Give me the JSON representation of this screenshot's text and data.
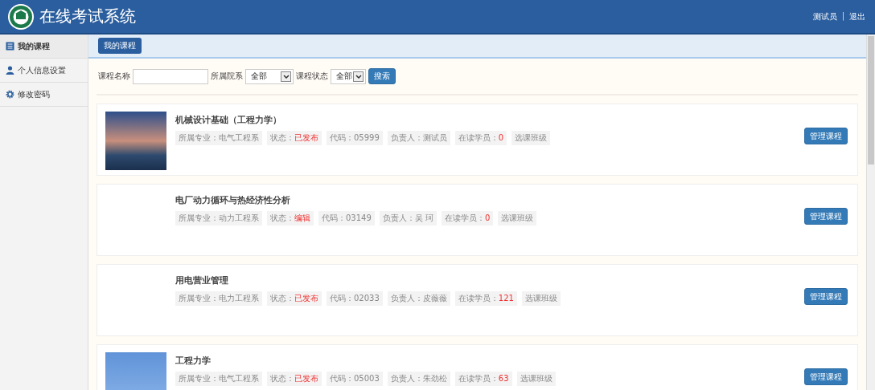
{
  "header": {
    "title": "在线考试系统",
    "user": "测试员",
    "separator": "|",
    "logout": "退出"
  },
  "sidebar": {
    "items": [
      {
        "label": "我的课程",
        "selected": true
      },
      {
        "label": "个人信息设置",
        "selected": false
      },
      {
        "label": "修改密码",
        "selected": false
      }
    ]
  },
  "tabs": [
    {
      "label": "我的课程",
      "selected": true
    }
  ],
  "filters": {
    "name_label": "课程名称",
    "department_label": "所属院系",
    "department_value": "全部",
    "status_label": "课程状态",
    "status_value": "全部",
    "search_button": "搜索"
  },
  "courses": [
    {
      "title": "机械设计基础（工程力学）",
      "photo": true,
      "tags": [
        {
          "label": "所属专业：",
          "value": "电气工程系",
          "emphasis": false
        },
        {
          "label": "状态：",
          "value": "已发布",
          "emphasis": true
        },
        {
          "label": "代码：",
          "value": "05999",
          "emphasis": false
        },
        {
          "label": "负责人：",
          "value": "测试员",
          "emphasis": false
        },
        {
          "label": "在读学员：",
          "value": "0",
          "emphasis": true
        },
        {
          "label": "选课班级"
        }
      ],
      "button": "管理课程"
    },
    {
      "title": "电厂动力循环与热经济性分析",
      "photo": false,
      "tags": [
        {
          "label": "所属专业：",
          "value": "动力工程系",
          "emphasis": false
        },
        {
          "label": "状态：",
          "value": "编辑",
          "emphasis": true
        },
        {
          "label": "代码：",
          "value": "03149",
          "emphasis": false
        },
        {
          "label": "负责人：",
          "value": "吴 珂",
          "emphasis": false
        },
        {
          "label": "在读学员：",
          "value": "0",
          "emphasis": true
        },
        {
          "label": "选课班级"
        }
      ],
      "button": "管理课程"
    },
    {
      "title": "用电营业管理",
      "photo": false,
      "tags": [
        {
          "label": "所属专业：",
          "value": "电力工程系",
          "emphasis": false
        },
        {
          "label": "状态：",
          "value": "已发布",
          "emphasis": true
        },
        {
          "label": "代码：",
          "value": "02033",
          "emphasis": false
        },
        {
          "label": "负责人：",
          "value": "皮薇薇",
          "emphasis": false
        },
        {
          "label": "在读学员：",
          "value": "121",
          "emphasis": true
        },
        {
          "label": "选课班级"
        }
      ],
      "button": "管理课程"
    },
    {
      "title": "工程力学",
      "photo": true,
      "tags": [
        {
          "label": "所属专业：",
          "value": "电气工程系",
          "emphasis": false
        },
        {
          "label": "状态：",
          "value": "已发布",
          "emphasis": true
        },
        {
          "label": "代码：",
          "value": "05003",
          "emphasis": false
        },
        {
          "label": "负责人：",
          "value": "朱劲松",
          "emphasis": false
        },
        {
          "label": "在读学员：",
          "value": "63",
          "emphasis": true
        },
        {
          "label": "选课班级"
        }
      ],
      "button": "管理课程"
    }
  ]
}
